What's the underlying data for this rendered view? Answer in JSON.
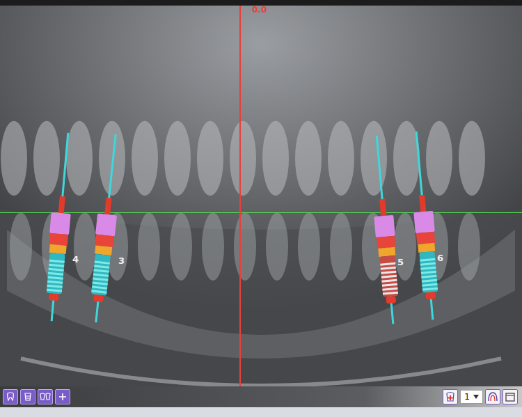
{
  "ruler": {
    "label": "0.0"
  },
  "implants": [
    {
      "label": "4",
      "selected": false
    },
    {
      "label": "3",
      "selected": false
    },
    {
      "label": "5",
      "selected": true
    },
    {
      "label": "6",
      "selected": false
    }
  ],
  "toolbar": {
    "view_select": {
      "value": "1"
    }
  }
}
